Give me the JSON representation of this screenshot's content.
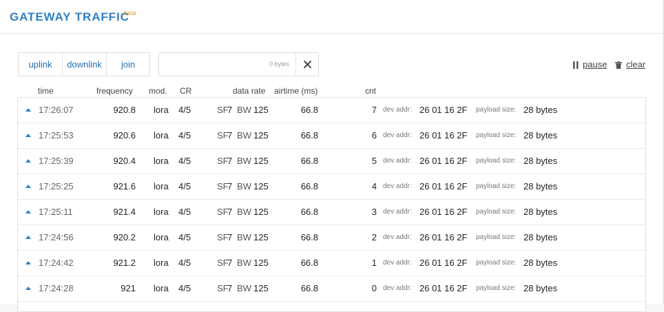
{
  "header": {
    "title": "GATEWAY TRAFFIC",
    "badge": "beta"
  },
  "filters": {
    "uplink": "uplink",
    "downlink": "downlink",
    "join": "join"
  },
  "search": {
    "size_label": "0 bytes",
    "clear_icon": "close-icon"
  },
  "actions": {
    "pause": "pause",
    "clear": "clear",
    "pause_icon": "pause-icon",
    "clear_icon": "trash-icon"
  },
  "columns": {
    "time": "time",
    "frequency": "frequency",
    "mod": "mod.",
    "cr": "CR",
    "data_rate": "data rate",
    "airtime": "airtime (ms)",
    "cnt": "cnt"
  },
  "labels": {
    "sf": "SF",
    "bw": "BW",
    "dev_addr": "dev addr:",
    "payload_size": "payload size:"
  },
  "rows": [
    {
      "direction": "uplink",
      "time": "17:26:07",
      "frequency": "920.8",
      "mod": "lora",
      "cr": "4/5",
      "sf": "7",
      "bw": "125",
      "airtime": "66.8",
      "cnt": "7",
      "dev_addr": "26 01 16 2F",
      "payload": "28 bytes"
    },
    {
      "direction": "uplink",
      "time": "17:25:53",
      "frequency": "920.6",
      "mod": "lora",
      "cr": "4/5",
      "sf": "7",
      "bw": "125",
      "airtime": "66.8",
      "cnt": "6",
      "dev_addr": "26 01 16 2F",
      "payload": "28 bytes"
    },
    {
      "direction": "uplink",
      "time": "17:25:39",
      "frequency": "920.4",
      "mod": "lora",
      "cr": "4/5",
      "sf": "7",
      "bw": "125",
      "airtime": "66.8",
      "cnt": "5",
      "dev_addr": "26 01 16 2F",
      "payload": "28 bytes"
    },
    {
      "direction": "uplink",
      "time": "17:25:25",
      "frequency": "921.6",
      "mod": "lora",
      "cr": "4/5",
      "sf": "7",
      "bw": "125",
      "airtime": "66.8",
      "cnt": "4",
      "dev_addr": "26 01 16 2F",
      "payload": "28 bytes"
    },
    {
      "direction": "uplink",
      "time": "17:25:11",
      "frequency": "921.4",
      "mod": "lora",
      "cr": "4/5",
      "sf": "7",
      "bw": "125",
      "airtime": "66.8",
      "cnt": "3",
      "dev_addr": "26 01 16 2F",
      "payload": "28 bytes"
    },
    {
      "direction": "uplink",
      "time": "17:24:56",
      "frequency": "920.2",
      "mod": "lora",
      "cr": "4/5",
      "sf": "7",
      "bw": "125",
      "airtime": "66.8",
      "cnt": "2",
      "dev_addr": "26 01 16 2F",
      "payload": "28 bytes"
    },
    {
      "direction": "uplink",
      "time": "17:24:42",
      "frequency": "921.2",
      "mod": "lora",
      "cr": "4/5",
      "sf": "7",
      "bw": "125",
      "airtime": "66.8",
      "cnt": "1",
      "dev_addr": "26 01 16 2F",
      "payload": "28 bytes"
    },
    {
      "direction": "uplink",
      "time": "17:24:28",
      "frequency": "921",
      "mod": "lora",
      "cr": "4/5",
      "sf": "7",
      "bw": "125",
      "airtime": "66.8",
      "cnt": "0",
      "dev_addr": "26 01 16 2F",
      "payload": "28 bytes"
    }
  ],
  "colors": {
    "accent": "#2f7fc1",
    "beta": "#e29a2b",
    "link": "#1f6fb2"
  }
}
